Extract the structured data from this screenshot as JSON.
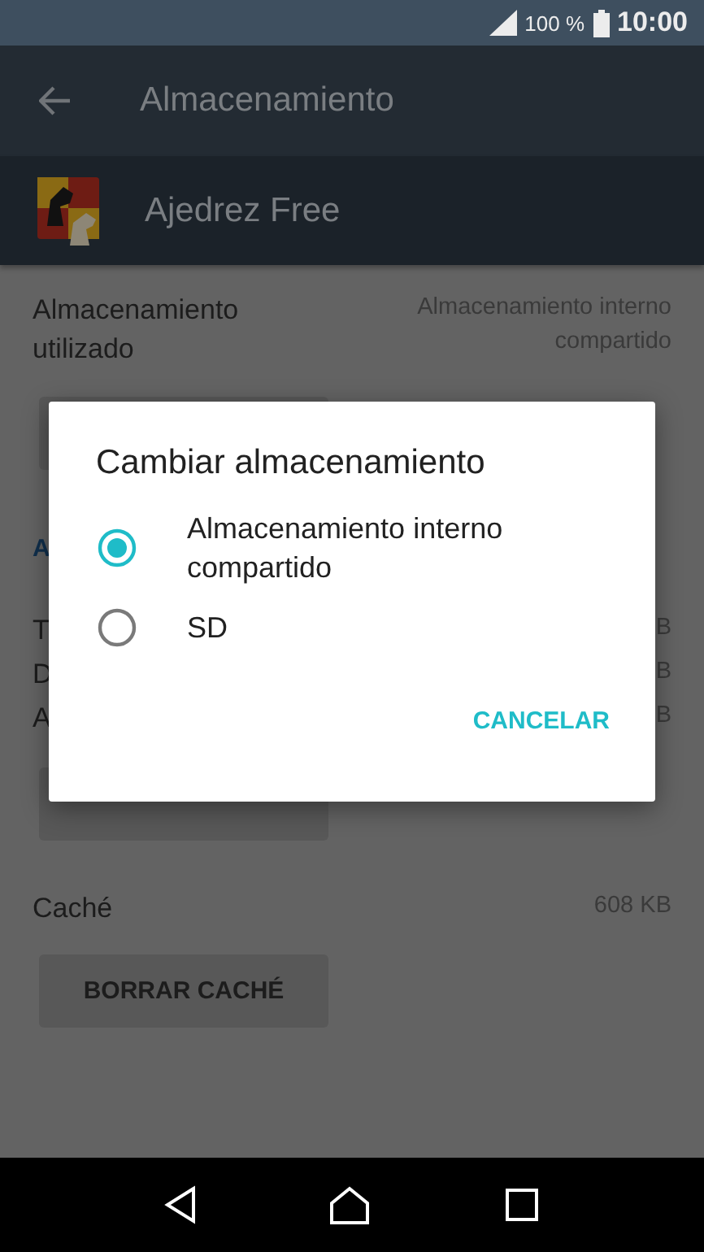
{
  "status_bar": {
    "battery": "100 %",
    "time": "10:00"
  },
  "app_bar": {
    "title": "Almacenamiento"
  },
  "app_header": {
    "name": "Ajedrez Free"
  },
  "storage_used": {
    "label": "Almacenamiento utilizado",
    "value": "Almacenamiento interno compartido"
  },
  "link": "A",
  "rows": [
    {
      "label": "T",
      "value": "B"
    },
    {
      "label": "D",
      "value": "B"
    },
    {
      "label": "A",
      "value": "B"
    }
  ],
  "cache": {
    "label": "Caché",
    "value": "608 KB"
  },
  "clear_cache_button": "BORRAR CACHÉ",
  "dialog": {
    "title": "Cambiar almacenamiento",
    "options": [
      {
        "label": "Almacenamiento interno compartido",
        "selected": true
      },
      {
        "label": "SD",
        "selected": false
      }
    ],
    "cancel": "CANCELAR"
  }
}
